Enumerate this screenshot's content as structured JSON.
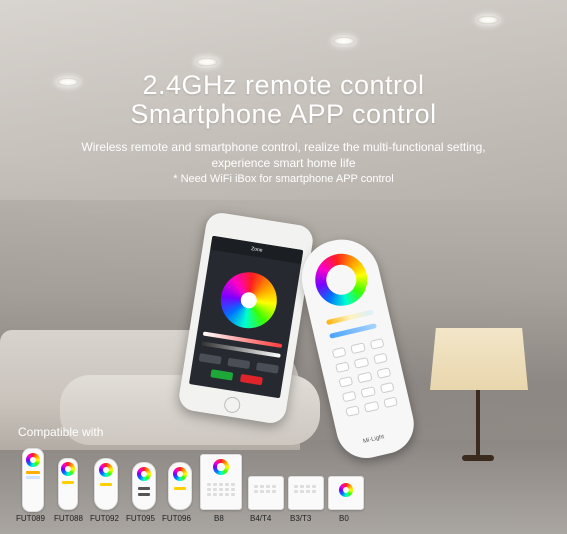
{
  "header": {
    "title_line1": "2.4GHz remote control",
    "title_line2": "Smartphone APP control",
    "subtitle_line1": "Wireless remote and smartphone control, realize the multi-functional setting,",
    "subtitle_line2": "experience smart home life",
    "note": "* Need WiFi iBox for smartphone APP control"
  },
  "phone": {
    "screen_title": "Zone"
  },
  "remote": {
    "brand": "Mi·Light"
  },
  "compatible": {
    "label": "Compatible with",
    "products": [
      {
        "name": "FUT089"
      },
      {
        "name": "FUT088"
      },
      {
        "name": "FUT092"
      },
      {
        "name": "FUT095"
      },
      {
        "name": "FUT096"
      },
      {
        "name": "B8"
      },
      {
        "name": "B4/T4"
      },
      {
        "name": "B3/T3"
      },
      {
        "name": "B0"
      }
    ]
  },
  "colors": {
    "text": "#ffffff",
    "lamp": "#f3e6c8"
  }
}
